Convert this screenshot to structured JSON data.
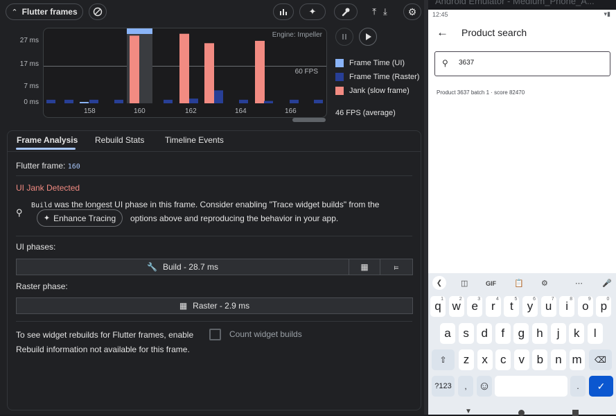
{
  "toolbar": {
    "flutter_frames_label": "Flutter frames"
  },
  "chart_data": {
    "type": "bar",
    "title": "",
    "engine_label": "Engine: Impeller",
    "y_ticks": [
      "27 ms",
      "17 ms",
      "7 ms",
      "0 ms"
    ],
    "fps_line_label": "60 FPS",
    "x_ticks": [
      "158",
      "160",
      "162",
      "164",
      "166"
    ],
    "selected_frame": 160,
    "series": [
      {
        "name": "Frame Time (UI)",
        "color": "#8ab4f8"
      },
      {
        "name": "Frame Time (Raster)",
        "color": "#283f96"
      },
      {
        "name": "Jank (slow frame)",
        "color": "#f28b82"
      }
    ],
    "bars": [
      {
        "kind": "raster",
        "v": 1.5
      },
      {
        "kind": "raster",
        "v": 1.5
      },
      {
        "kind": "ui",
        "v": 0.5
      },
      {
        "kind": "raster",
        "v": 1.5
      },
      {
        "kind": "raster",
        "v": 1.5
      },
      {
        "kind": "jank",
        "v": 28.7,
        "selected": true
      },
      {
        "kind": "raster",
        "v": 1.5
      },
      {
        "kind": "jank",
        "v": 29.5
      },
      {
        "kind": "raster",
        "v": 2
      },
      {
        "kind": "jank",
        "v": 25.5
      },
      {
        "kind": "raster",
        "v": 5.5
      },
      {
        "kind": "raster",
        "v": 1.5
      },
      {
        "kind": "jank",
        "v": 26.5
      },
      {
        "kind": "raster",
        "v": 1
      },
      {
        "kind": "raster",
        "v": 1.5
      },
      {
        "kind": "raster",
        "v": 1.5
      }
    ],
    "ylim": [
      0,
      30
    ],
    "fps_average": "46 FPS (average)"
  },
  "details": {
    "tabs": [
      "Frame Analysis",
      "Rebuild Stats",
      "Timeline Events"
    ],
    "flutter_frame_label": "Flutter frame:",
    "flutter_frame_value": "160",
    "jank_title": "UI Jank Detected",
    "hint_code": "Build",
    "hint_text1": "was the longest UI phase in this frame. Consider enabling \"Trace widget builds\" from the",
    "enhance_button": "Enhance Tracing",
    "hint_text2": "options above and reproducing the behavior in your app.",
    "ui_phases_label": "UI phases:",
    "build_bar": "Build - 28.7 ms",
    "raster_phase_label": "Raster phase:",
    "raster_bar": "Raster - 2.9 ms",
    "rebuild_text": "To see widget rebuilds for Flutter frames, enable",
    "count_widget_builds": "Count widget builds",
    "rebuild_unavailable": "Rebuild information not available for this frame."
  },
  "emulator": {
    "title": "Android Emulator - Medium_Phone_A...",
    "time": "12:45",
    "app_title": "Product search",
    "search_value": "3637",
    "result_text": "Product 3637 batch 1 · score 82470",
    "row1": [
      "q",
      "w",
      "e",
      "r",
      "t",
      "y",
      "u",
      "i",
      "o",
      "p"
    ],
    "row1_sup": [
      "1",
      "2",
      "3",
      "4",
      "5",
      "6",
      "7",
      "8",
      "9",
      "0"
    ],
    "row2": [
      "a",
      "s",
      "d",
      "f",
      "g",
      "h",
      "j",
      "k",
      "l"
    ],
    "row3": [
      "z",
      "x",
      "c",
      "v",
      "b",
      "n",
      "m"
    ],
    "sym_key": "?123",
    "comma_key": ",",
    "period_key": ".",
    "gif_label": "GIF"
  }
}
